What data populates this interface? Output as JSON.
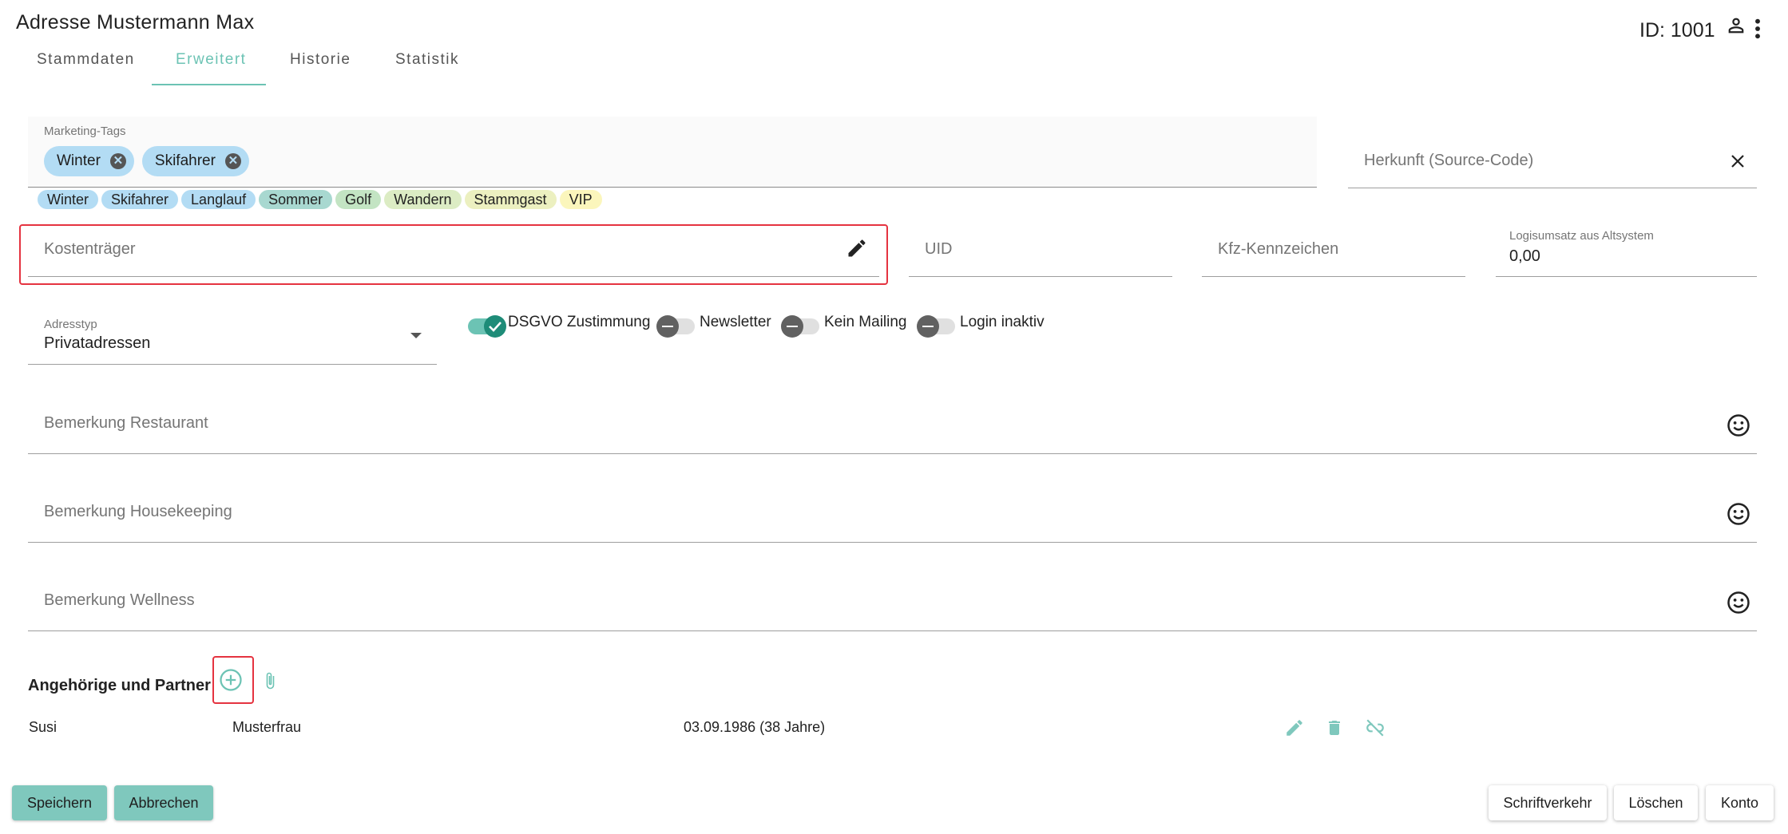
{
  "header": {
    "title": "Adresse Mustermann Max",
    "id_text": "ID: 1001"
  },
  "tabs": [
    {
      "label": "Stammdaten",
      "active": false
    },
    {
      "label": "Erweitert",
      "active": true
    },
    {
      "label": "Historie",
      "active": false
    },
    {
      "label": "Statistik",
      "active": false
    }
  ],
  "colors": {
    "accent": "#6cc3b4",
    "highlight_border": "#e53340",
    "button_teal": "#7fc8bd"
  },
  "marketing_tags": {
    "label": "Marketing-Tags",
    "selected": [
      "Winter",
      "Skifahrer"
    ],
    "palette": [
      {
        "label": "Winter",
        "color": "#b3dcf4"
      },
      {
        "label": "Skifahrer",
        "color": "#b3dcf4"
      },
      {
        "label": "Langlauf",
        "color": "#b3dcf4"
      },
      {
        "label": "Sommer",
        "color": "#a8d8d0"
      },
      {
        "label": "Golf",
        "color": "#c3e4c3"
      },
      {
        "label": "Wandern",
        "color": "#dcecc4"
      },
      {
        "label": "Stammgast",
        "color": "#ecf0c0"
      },
      {
        "label": "VIP",
        "color": "#fbf6bc"
      }
    ]
  },
  "fields": {
    "herkunft_placeholder": "Herkunft (Source-Code)",
    "kostentraeger_placeholder": "Kostenträger",
    "uid_placeholder": "UID",
    "kfz_placeholder": "Kfz-Kennzeichen",
    "logis_label": "Logisumsatz aus Altsystem",
    "logis_value": "0,00",
    "adresstyp_label": "Adresstyp",
    "adresstyp_value": "Privatadressen",
    "bem_restaurant": "Bemerkung Restaurant",
    "bem_housekeeping": "Bemerkung Housekeeping",
    "bem_wellness": "Bemerkung Wellness"
  },
  "toggles": [
    {
      "label": "DSGVO Zustimmung",
      "on": true
    },
    {
      "label": "Newsletter",
      "on": false
    },
    {
      "label": "Kein Mailing",
      "on": false
    },
    {
      "label": "Login inaktiv",
      "on": false
    }
  ],
  "relatives": {
    "title": "Angehörige und Partner",
    "rows": [
      {
        "first_name": "Susi",
        "last_name": "Musterfrau",
        "birthdate": "03.09.1986 (38 Jahre)"
      }
    ]
  },
  "buttons": {
    "save": "Speichern",
    "cancel": "Abbrechen",
    "correspondence": "Schriftverkehr",
    "delete": "Löschen",
    "account": "Konto"
  },
  "icons": {
    "person": "person-outline-icon",
    "more": "more-vert-icon",
    "close": "close-icon",
    "edit": "pencil-icon",
    "dropdown": "chevron-down-icon",
    "emoji": "smiley-icon",
    "add": "add-circle-icon",
    "attach": "paperclip-icon",
    "delete": "trash-icon",
    "unlink": "link-off-icon"
  }
}
